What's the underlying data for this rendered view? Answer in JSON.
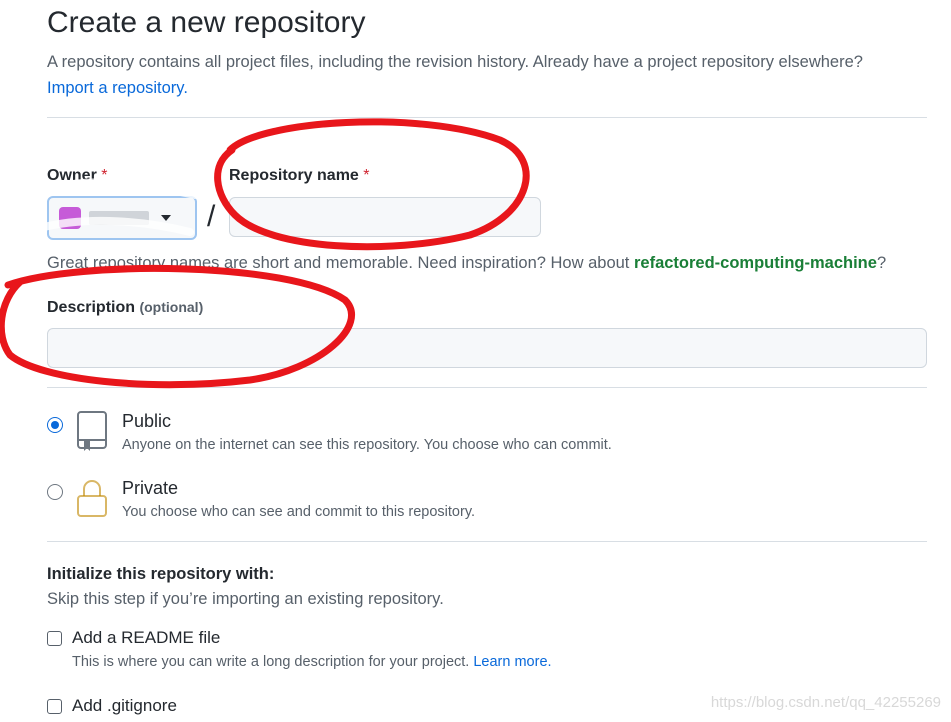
{
  "header": {
    "title": "Create a new repository",
    "intro": "A repository contains all project files, including the revision history. Already have a project repository elsewhere?",
    "import_link": "Import a repository."
  },
  "owner": {
    "label": "Owner",
    "required_mark": "*",
    "separator": "/"
  },
  "repository": {
    "label": "Repository name",
    "required_mark": "*",
    "value": ""
  },
  "hint": {
    "text": "Great repository names are short and memorable. Need inspiration? How about",
    "suggestion": "refactored-computing-machine",
    "end": "?"
  },
  "description": {
    "label": "Description",
    "optional": "(optional)",
    "value": ""
  },
  "visibility": {
    "public": {
      "title": "Public",
      "desc": "Anyone on the internet can see this repository. You choose who can commit.",
      "selected": true
    },
    "private": {
      "title": "Private",
      "desc": "You choose who can see and commit to this repository.",
      "selected": false
    }
  },
  "initialize": {
    "title": "Initialize this repository with:",
    "subtitle": "Skip this step if you’re importing an existing repository.",
    "readme_label": "Add a README file",
    "readme_desc": "This is where you can write a long description for your project.",
    "readme_link": "Learn more.",
    "gitignore_label": "Add .gitignore"
  },
  "watermark": "https://blog.csdn.net/qq_42255269",
  "colors": {
    "link": "#0969da",
    "suggestion": "#1a7f37",
    "required": "#cf222e",
    "annotation": "#e8161b"
  }
}
